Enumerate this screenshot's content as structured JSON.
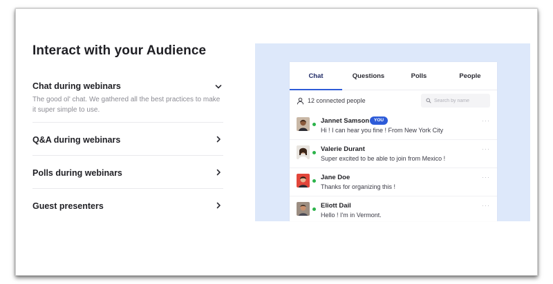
{
  "section": {
    "title": "Interact with your Audience"
  },
  "accordion": {
    "items": [
      {
        "title": "Chat during webinars",
        "description": "The good ol' chat. We gathered all the best practices to make it super simple to use.",
        "expanded": true,
        "icon": "chevron-down-icon"
      },
      {
        "title": "Q&A during webinars",
        "expanded": false,
        "icon": "chevron-right-icon"
      },
      {
        "title": "Polls during webinars",
        "expanded": false,
        "icon": "chevron-right-icon"
      },
      {
        "title": "Guest presenters",
        "expanded": false,
        "icon": "chevron-right-icon"
      }
    ]
  },
  "chat_panel": {
    "tabs": [
      {
        "label": "Chat",
        "active": true
      },
      {
        "label": "Questions",
        "active": false
      },
      {
        "label": "Polls",
        "active": false
      },
      {
        "label": "People",
        "active": false
      }
    ],
    "connected_text": "12 connected people",
    "search_placeholder": "Search by name",
    "you_badge": "YOU",
    "messages": [
      {
        "name": "Jannet Samson",
        "text": "Hi ! I can hear you fine ! From New York City",
        "is_you": true,
        "online": true
      },
      {
        "name": "Valerie Durant",
        "text": "Super excited to be able to join from Mexico !",
        "is_you": false,
        "online": true
      },
      {
        "name": "Jane Doe",
        "text": "Thanks for organizing this !",
        "is_you": false,
        "online": true
      },
      {
        "name": "Eliott Dail",
        "text": "Hello ! I'm in Vermont.",
        "is_you": false,
        "online": true
      }
    ],
    "more_label": "···"
  },
  "colors": {
    "accent": "#2d5bd8",
    "panel_background": "#dde8fa",
    "online": "#2bb34a",
    "text_dark": "#1f1f24",
    "text_muted": "#8b8b93"
  }
}
